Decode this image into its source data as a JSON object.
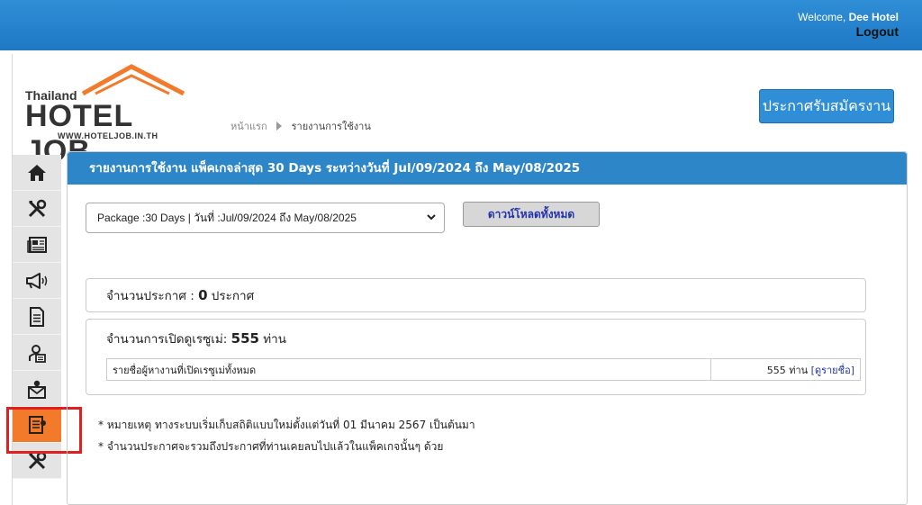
{
  "header": {
    "welcome_prefix": "Welcome,",
    "username": "Dee Hotel",
    "logout": "Logout"
  },
  "logo": {
    "line1": "Thailand",
    "line2": "HOTEL JOB",
    "line3": "WWW.HOTELJOB.IN.TH"
  },
  "breadcrumb": {
    "home": "หน้าแรก",
    "current": "รายงานการใช้งาน"
  },
  "post_job_button": "ประกาศรับสมัครงาน",
  "sidebar": {
    "items": [
      {
        "icon": "home-icon"
      },
      {
        "icon": "tools-icon"
      },
      {
        "icon": "newspaper-icon"
      },
      {
        "icon": "megaphone-icon"
      },
      {
        "icon": "document-icon"
      },
      {
        "icon": "profile-card-icon"
      },
      {
        "icon": "envelope-person-icon"
      },
      {
        "icon": "report-icon",
        "active": true
      },
      {
        "icon": "tools-icon"
      }
    ]
  },
  "panel": {
    "title": "รายงานการใช้งาน แพ็คเกจล่าสุด 30 Days ระหว่างวันที่ Jul/09/2024 ถึง May/08/2025",
    "package_select": "Package :30 Days | วันที่ :Jul/09/2024 ถึง May/08/2025",
    "download_button": "ดาวน์โหลดทั้งหมด",
    "announcements_label": "จำนวนประกาศ :",
    "announcements_count": "0",
    "announcements_unit": "ประกาศ",
    "resume_views_label": "จำนวนการเปิดดูเรซูเม่:",
    "resume_views_count": "555",
    "resume_views_unit": "ท่าน",
    "table_label": "รายชื่อผู้หางานที่เปิดเรซูเม่ทั้งหมด",
    "table_value": "555 ท่าน",
    "table_link": "[ดูรายชื่อ]",
    "note1": "* หมายเหตุ ทางระบบเริ่มเก็บสถิติแบบใหม่ตั้งแต่วันที่ 01 มีนาคม 2567 เป็นต้นมา",
    "note2": "* จำนวนประกาศจะรวมถึงประกาศที่ท่านเคยลบไปแล้วในแพ็คเกจนั้นๆ ด้วย"
  },
  "colors": {
    "header_blue": "#2f8ed6",
    "accent_orange": "#f47a2b",
    "highlight_red": "#e02020"
  }
}
